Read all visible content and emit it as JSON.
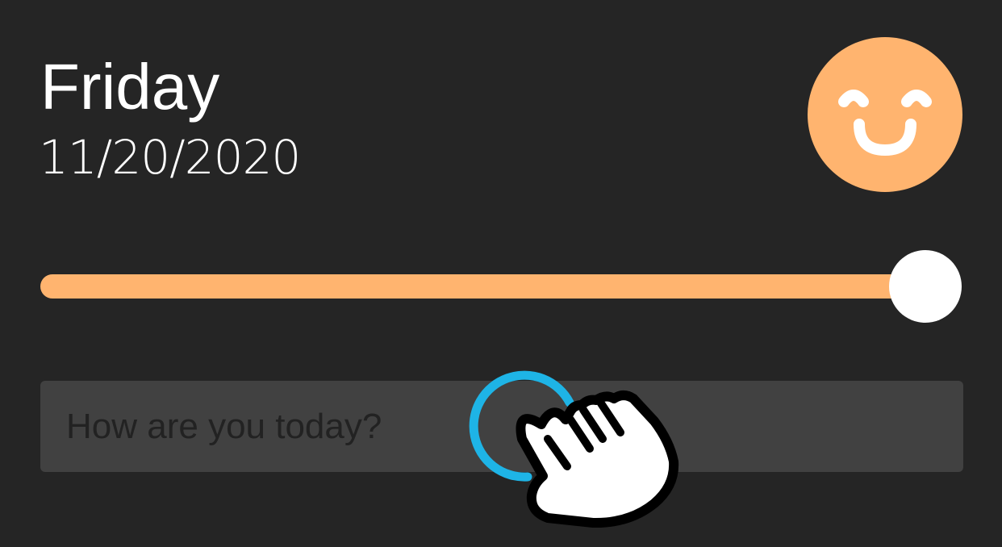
{
  "header": {
    "day": "Friday",
    "date": "11/20/2020"
  },
  "mood": {
    "icon": "smiling-face-icon",
    "color": "#ffb46f",
    "level": 1.0
  },
  "entry": {
    "placeholder": "How are you today?",
    "value": ""
  },
  "overlay": {
    "gesture_icon": "pointing-hand-icon",
    "ripple_color": "#1eb4e6"
  },
  "theme": {
    "background": "#252525",
    "field_background": "#414141",
    "accent": "#ffb46f"
  }
}
